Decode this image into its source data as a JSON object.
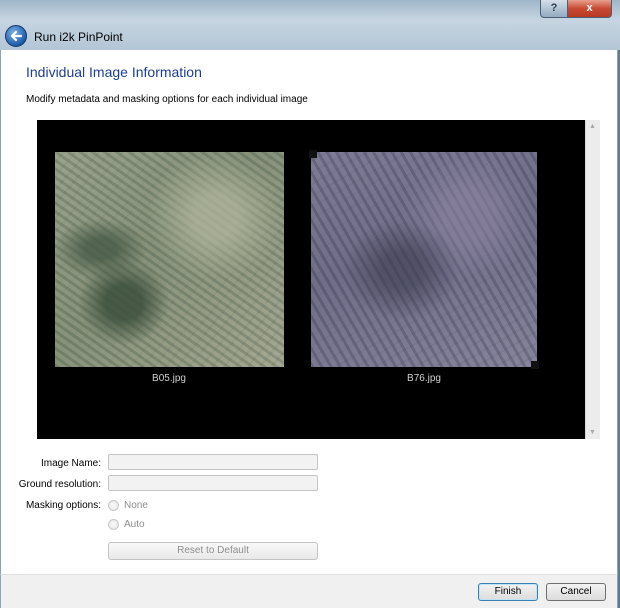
{
  "window": {
    "title": "Run i2k PinPoint",
    "help_label": "?",
    "close_label": "x"
  },
  "page": {
    "heading": "Individual Image Information",
    "description": "Modify metadata and masking options for each individual image"
  },
  "viewer": {
    "images": [
      {
        "name": "B05.jpg"
      },
      {
        "name": "B76.jpg"
      }
    ]
  },
  "form": {
    "image_name_label": "Image Name:",
    "image_name_value": "",
    "ground_resolution_label": "Ground resolution:",
    "ground_resolution_value": "",
    "masking_label": "Masking options:",
    "masking_options": [
      "None",
      "Auto"
    ],
    "reset_label": "Reset to Default"
  },
  "footer": {
    "finish_label": "Finish",
    "cancel_label": "Cancel"
  },
  "colors": {
    "heading": "#1c3f94",
    "viewer_bg": "#000000",
    "default_button_border": "#3c7fb1"
  },
  "icons": {
    "back": "back-arrow-icon"
  }
}
